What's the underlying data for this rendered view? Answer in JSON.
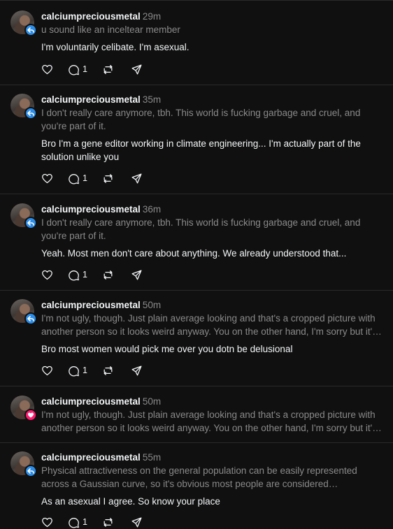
{
  "threads": [
    {
      "username": "calciumpreciousmetal",
      "time": "29m",
      "badge": {
        "type": "reply",
        "color": "#2b8de8",
        "icon": "reply-arrow-icon"
      },
      "quote": "u sound like an inceltear member",
      "reply": "I'm voluntarily celibate. I'm asexual.",
      "comment_count": "1"
    },
    {
      "username": "calciumpreciousmetal",
      "time": "35m",
      "badge": {
        "type": "reply",
        "color": "#2b8de8",
        "icon": "reply-arrow-icon"
      },
      "quote": "I don't really care anymore, tbh. This world is fucking garbage and cruel, and you're part of it.",
      "reply": "Bro I'm a gene editor working in climate engineering... I'm actually part of the solution unlike you",
      "comment_count": "1"
    },
    {
      "username": "calciumpreciousmetal",
      "time": "36m",
      "badge": {
        "type": "reply",
        "color": "#2b8de8",
        "icon": "reply-arrow-icon"
      },
      "quote": "I don't really care anymore, tbh. This world is fucking garbage and cruel, and you're part of it.",
      "reply": "Yeah. Most men don't care about anything. We already understood that...",
      "comment_count": "1"
    },
    {
      "username": "calciumpreciousmetal",
      "time": "50m",
      "badge": {
        "type": "reply",
        "color": "#2b8de8",
        "icon": "reply-arrow-icon"
      },
      "quote": "I'm not ugly, though. Just plain average looking and that's a cropped picture with another person so it looks weird anyway. You on the other hand, I'm sorry but it's really not a good look.",
      "reply": "Bro most women would pick me over you dotn be delusional",
      "comment_count": "1"
    },
    {
      "username": "calciumpreciousmetal",
      "time": "50m",
      "badge": {
        "type": "like",
        "color": "#ff1a6e",
        "icon": "heart-icon"
      },
      "quote": "I'm not ugly, though. Just plain average looking and that's a cropped picture with another person so it looks weird anyway. You on the other hand, I'm sorry but it's really not a good look.",
      "reply": "",
      "comment_count": ""
    },
    {
      "username": "calciumpreciousmetal",
      "time": "55m",
      "badge": {
        "type": "reply",
        "color": "#2b8de8",
        "icon": "reply-arrow-icon"
      },
      "quote": "Physical attractiveness on the general population can be easily represented across a Gaussian curve, so it's obvious most people are considered \"ugly/unattractive\" by the standards.",
      "reply": "As an asexual I agree. So know your place",
      "comment_count": "1"
    }
  ]
}
